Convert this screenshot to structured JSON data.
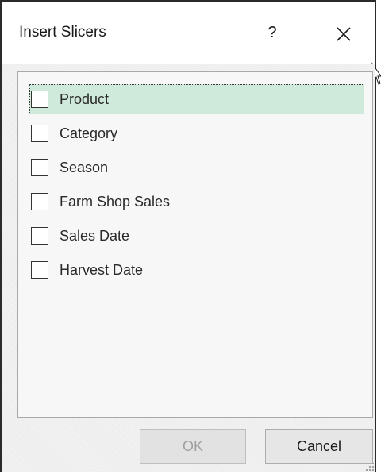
{
  "dialog": {
    "title": "Insert Slicers",
    "help_label": "?",
    "close_icon": "close-icon"
  },
  "fields": [
    {
      "label": "Product",
      "checked": false,
      "selected": true
    },
    {
      "label": "Category",
      "checked": false,
      "selected": false
    },
    {
      "label": "Season",
      "checked": false,
      "selected": false
    },
    {
      "label": "Farm Shop Sales",
      "checked": false,
      "selected": false
    },
    {
      "label": "Sales Date",
      "checked": false,
      "selected": false
    },
    {
      "label": "Harvest Date",
      "checked": false,
      "selected": false
    }
  ],
  "buttons": {
    "ok_label": "OK",
    "ok_enabled": false,
    "cancel_label": "Cancel"
  },
  "colors": {
    "selected_row": "#cfeadb",
    "disabled_text": "#a0a0a0"
  }
}
